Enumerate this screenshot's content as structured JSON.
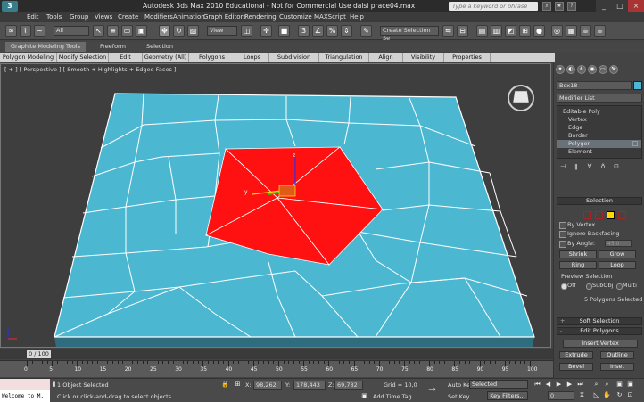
{
  "titlebar": {
    "title": "Autodesk 3ds Max 2010   Educational - Not for Commercial Use      dalsi prace04.max",
    "search_placeholder": "Type a keyword or phrase"
  },
  "menu": [
    "Edit",
    "Tools",
    "Group",
    "Views",
    "Create",
    "Modifiers",
    "Animation",
    "Graph Editors",
    "Rendering",
    "Customize",
    "MAXScript",
    "Help"
  ],
  "toolbar": {
    "filter_value": "All",
    "refcoord_value": "View",
    "selection_set_value": "Create Selection Se"
  },
  "ribbon_tabs": [
    "Graphite Modeling Tools",
    "Freeform",
    "Selection"
  ],
  "ribbon_items": [
    "Polygon Modeling",
    "Modify Selection",
    "Edit",
    "Geometry (All)",
    "Polygons",
    "Loops",
    "Subdivision",
    "Triangulation",
    "Align",
    "Visibility",
    "Properties"
  ],
  "viewport": {
    "label": "[ + ] [ Perspective ] [ Smooth + Highlights + Edged Faces ]"
  },
  "command_panel": {
    "object_name": "Box18",
    "object_color": "#4db8d5",
    "modifier_list": "Modifier List",
    "stack": [
      "Editable Poly",
      "Vertex",
      "Edge",
      "Border",
      "Polygon",
      "Element"
    ],
    "stack_selected": "Polygon",
    "selection_title": "Selection",
    "by_vertex": "By Vertex",
    "ignore_backfacing": "Ignore Backfacing",
    "by_angle": "By Angle:",
    "angle_value": "45,0",
    "shrink": "Shrink",
    "grow": "Grow",
    "ring": "Ring",
    "loop": "Loop",
    "preview_selection": "Preview Selection",
    "preview_off": "Off",
    "preview_subobj": "SubObj",
    "preview_multi": "Multi",
    "selected_info": "5 Polygons Selected",
    "soft_selection": "Soft Selection",
    "edit_polygons": "Edit Polygons",
    "insert_vertex": "Insert Vertex",
    "extrude": "Extrude",
    "outline": "Outline",
    "bevel": "Bevel",
    "inset": "Inset"
  },
  "timeline": {
    "frame_label": "0 / 100",
    "current_frame": 0,
    "total_frames": 100,
    "ticks": [
      "0",
      "5",
      "10",
      "15",
      "20",
      "25",
      "30",
      "35",
      "40",
      "45",
      "50",
      "55",
      "60",
      "65",
      "70",
      "75",
      "80",
      "85",
      "90",
      "95",
      "100"
    ]
  },
  "status": {
    "maxscript_text": "Welcome to M.",
    "objects_selected": "1 Object Selected",
    "prompt": "Click or click-and-drag to select objects",
    "x_label": "X:",
    "x_value": "98,262",
    "y_label": "Y:",
    "y_value": "178,443",
    "z_label": "Z:",
    "z_value": "69,782",
    "grid": "Grid = 10,0",
    "add_time_tag": "Add Time Tag",
    "auto_key": "Auto Key",
    "set_key": "Set Key",
    "key_filter_value": "Selected",
    "key_filters": "Key Filters...",
    "frame_value": "0"
  },
  "colors": {
    "plane": "#4cb7d1",
    "selected_polygons": "#ff1111",
    "wire": "#ffffff",
    "viewport_bg": "#3e3e3e"
  }
}
